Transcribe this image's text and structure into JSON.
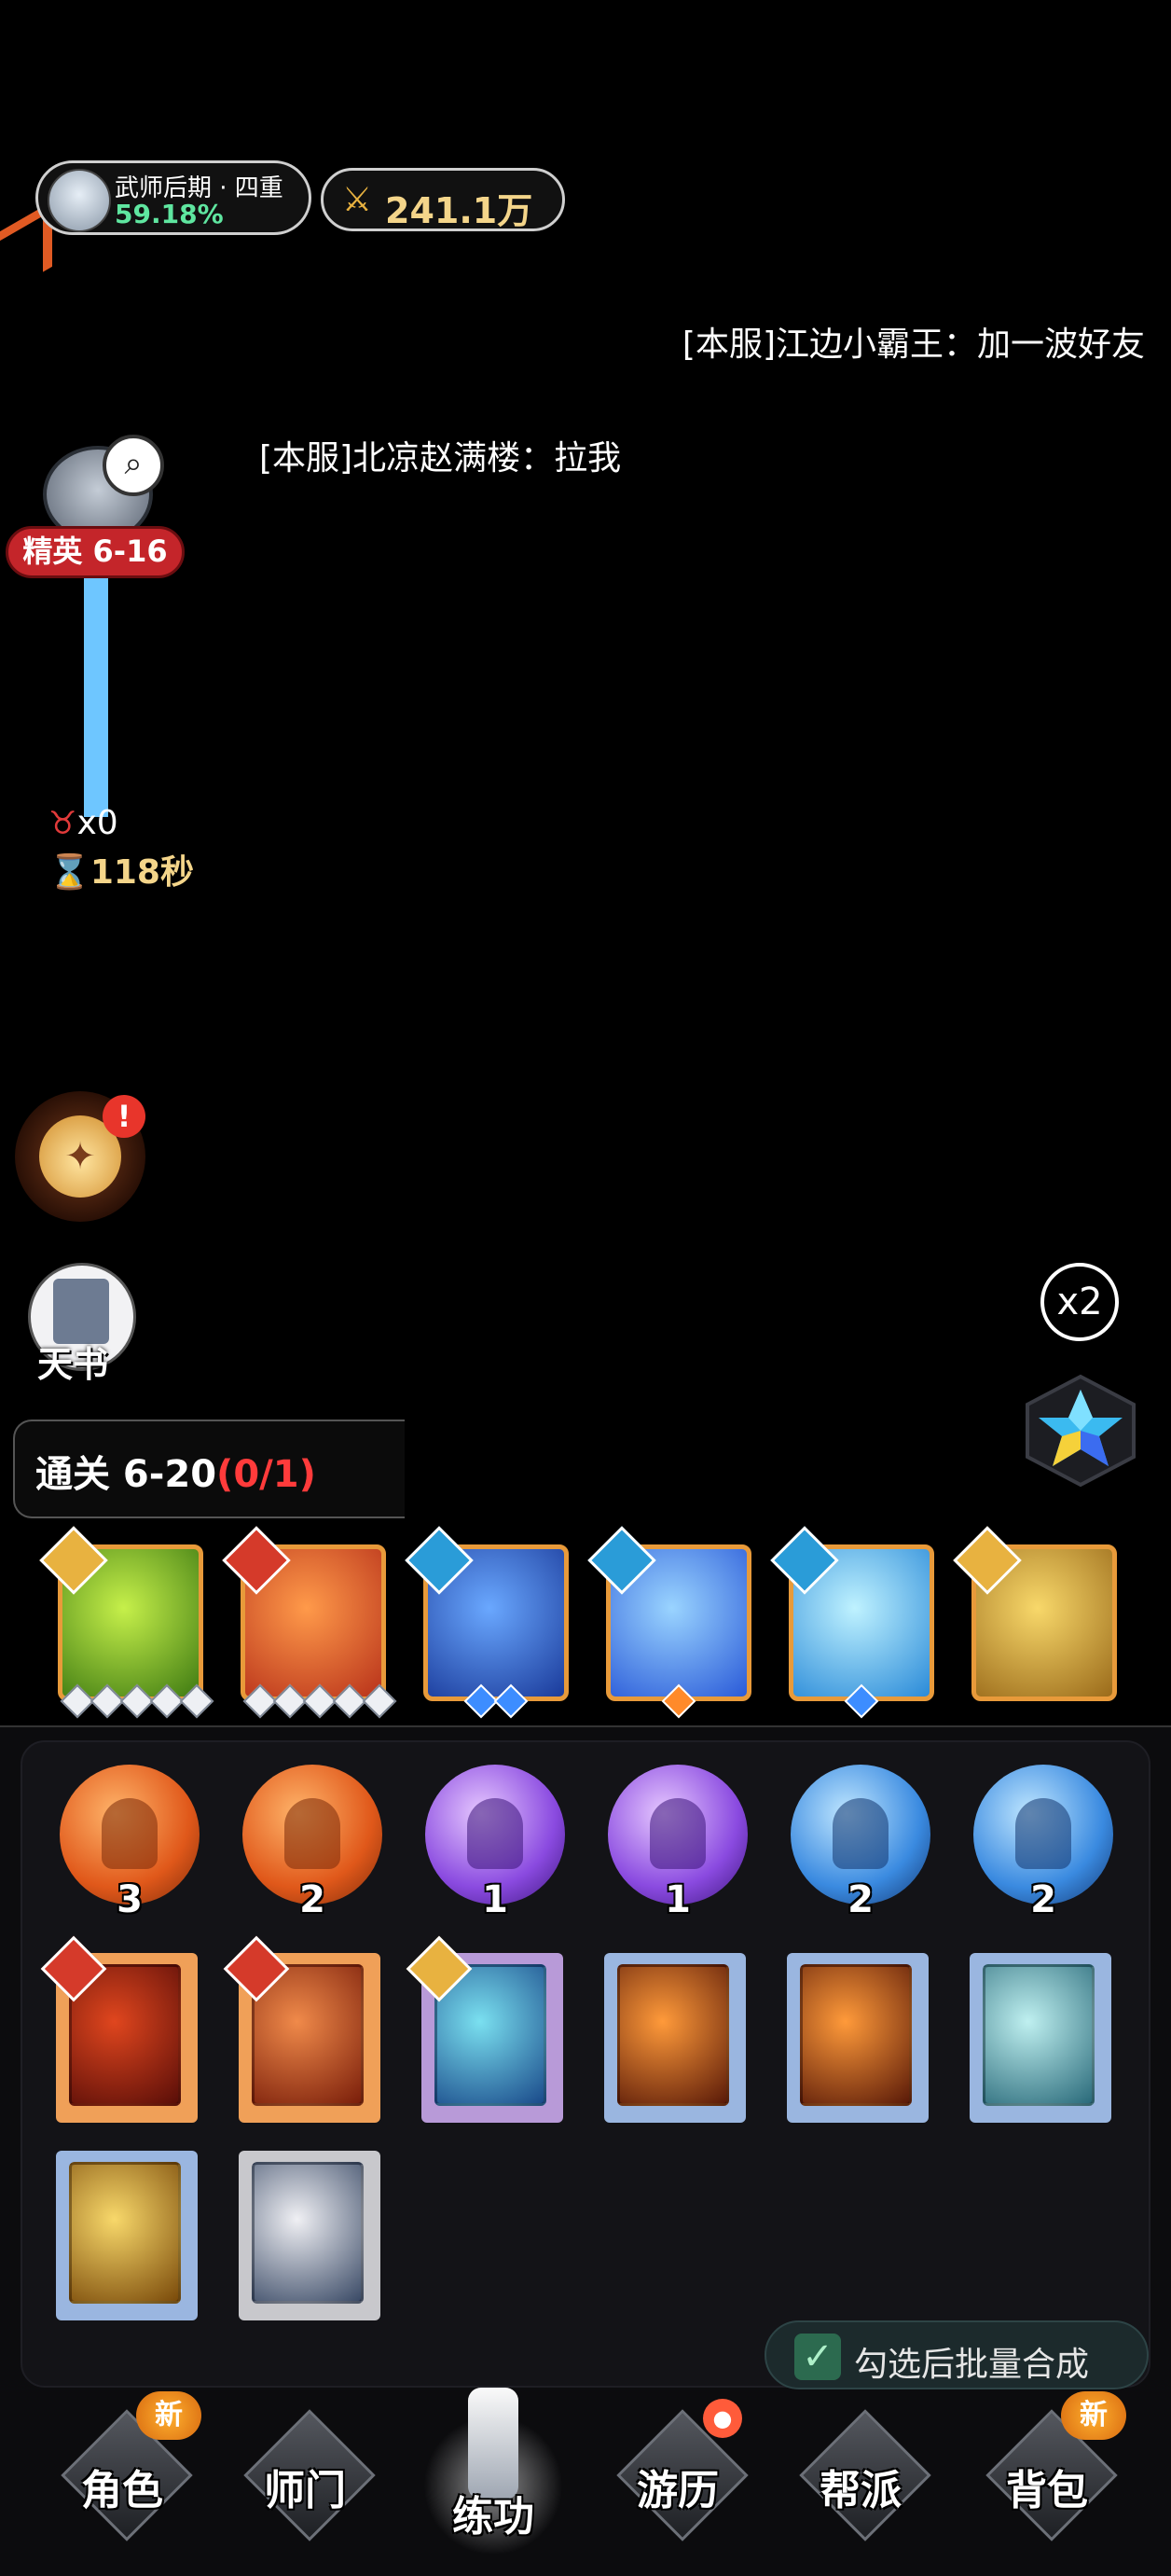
{
  "header": {
    "rank_title": "武师后期 · 四重",
    "rank_progress": "59.18%",
    "power": "241.1万"
  },
  "chat": [
    "[本服]江边小霸王：加一波好友",
    "[本服]北凉赵满楼：拉我"
  ],
  "boss": {
    "stage_label": "精英 6-16",
    "kills": "x0",
    "time_left": "118秒",
    "progress": 1.0
  },
  "side": {
    "book_label": "天书",
    "alert": "!",
    "speed": "x2"
  },
  "quest": {
    "prefix": "通关 6-20",
    "count": "(0/1)"
  },
  "equipped_skills": [
    {
      "badge_color": "#e8b240",
      "gradient": [
        "#c6f04a",
        "#3e7a12"
      ],
      "pips": [
        "grey",
        "grey",
        "grey",
        "grey",
        "grey"
      ]
    },
    {
      "badge_color": "#d53a2a",
      "gradient": [
        "#ff9a4a",
        "#b8321a"
      ],
      "pips": [
        "grey",
        "grey",
        "grey",
        "grey",
        "grey"
      ]
    },
    {
      "badge_color": "#2a9cd8",
      "gradient": [
        "#6aa8ff",
        "#1a3a9a"
      ],
      "pips": [
        "blue",
        "blue"
      ]
    },
    {
      "badge_color": "#2a9cd8",
      "gradient": [
        "#9ad4ff",
        "#2a5ad8"
      ],
      "pips": [
        "orange"
      ]
    },
    {
      "badge_color": "#2a9cd8",
      "gradient": [
        "#bff2ff",
        "#2a8ad8"
      ],
      "pips": [
        "blue"
      ]
    },
    {
      "badge_color": "#e8b240",
      "gradient": [
        "#f8d86a",
        "#9a6a1a"
      ],
      "pips": []
    }
  ],
  "orbs": [
    {
      "count": "3",
      "color": "orange"
    },
    {
      "count": "2",
      "color": "orange"
    },
    {
      "count": "1",
      "color": "purple"
    },
    {
      "count": "1",
      "color": "purple"
    },
    {
      "count": "2",
      "color": "blue"
    },
    {
      "count": "2",
      "color": "blue"
    }
  ],
  "books": [
    {
      "frame": "#f0a058",
      "art": [
        "#e0461e",
        "#5a0e08"
      ],
      "badge": "#d53a2a"
    },
    {
      "frame": "#f0a058",
      "art": [
        "#f08a4a",
        "#7a1e0a"
      ],
      "badge": "#d53a2a"
    },
    {
      "frame": "#b89ad8",
      "art": [
        "#7ae0f0",
        "#1a4a8a"
      ],
      "badge": "#e8b240"
    },
    {
      "frame": "#9ab6e0",
      "art": [
        "#ff9a3a",
        "#5a1a08"
      ],
      "badge": ""
    },
    {
      "frame": "#9ab6e0",
      "art": [
        "#ff9a3a",
        "#5a1a08"
      ],
      "badge": ""
    },
    {
      "frame": "#9ab6e0",
      "art": [
        "#bff0f0",
        "#2a6a7a"
      ],
      "badge": ""
    },
    {
      "frame": "#9ab6e0",
      "art": [
        "#f8d86a",
        "#7a4a0a"
      ],
      "badge": ""
    },
    {
      "frame": "#c8c8cc",
      "art": [
        "#f0f0f4",
        "#3a4a66"
      ],
      "badge": ""
    }
  ],
  "merge": {
    "check": "✓",
    "label": "勾选后批量合成"
  },
  "nav": [
    {
      "label": "角色",
      "badge": "新"
    },
    {
      "label": "师门",
      "badge": ""
    },
    {
      "label": "练功",
      "badge": "",
      "active": true
    },
    {
      "label": "游历",
      "badge": "bubble"
    },
    {
      "label": "帮派",
      "badge": ""
    },
    {
      "label": "背包",
      "badge": "新"
    }
  ],
  "colors": {
    "accent_gold": "#f4d58a",
    "alert_red": "#c4252a",
    "progress_blue": "#6ec6ff",
    "quest_red": "#ff3b3b"
  }
}
